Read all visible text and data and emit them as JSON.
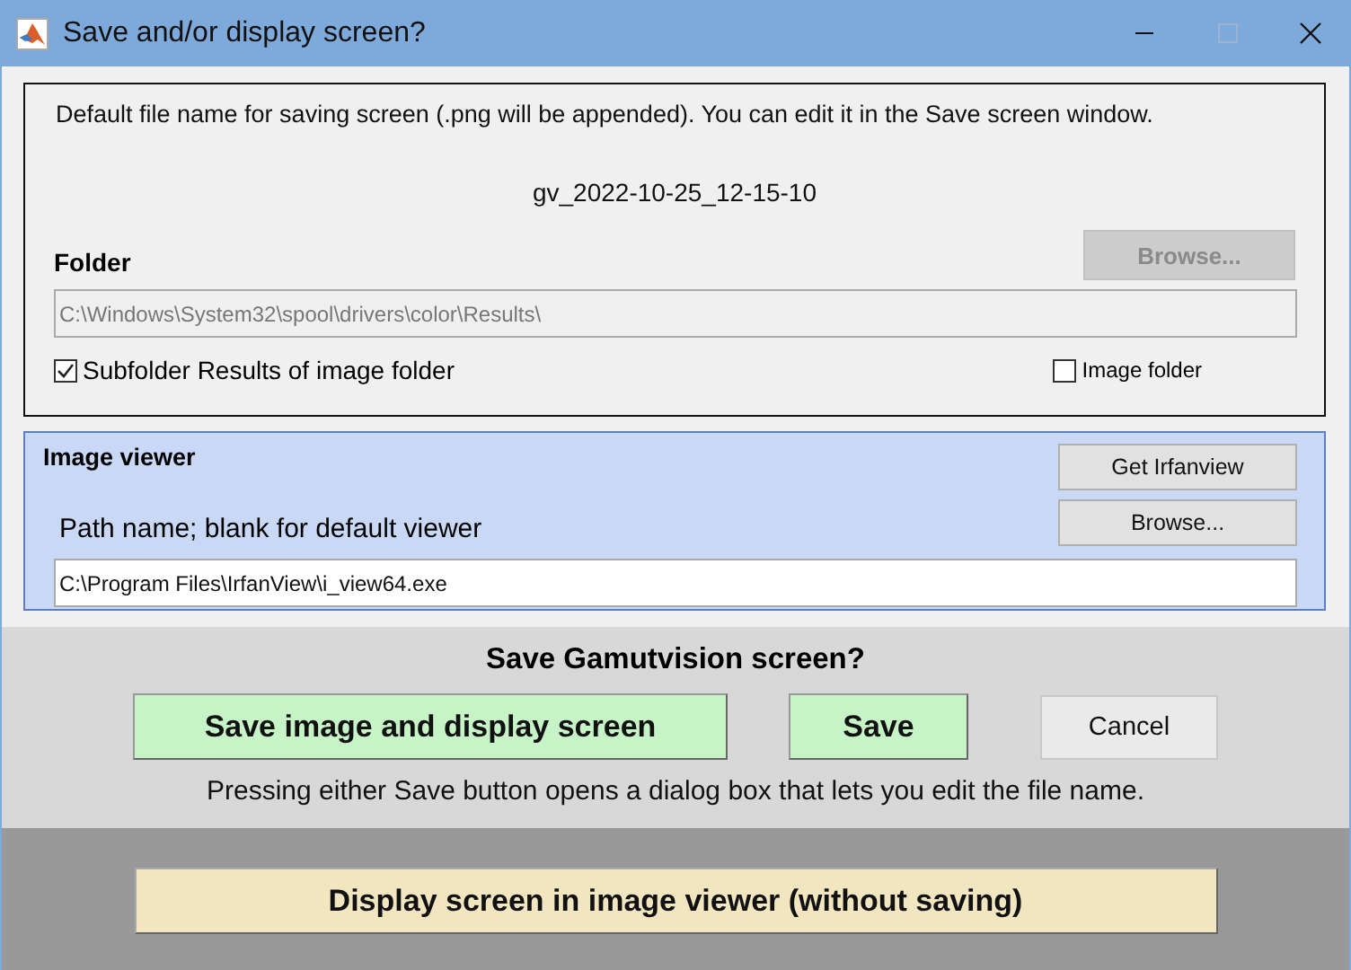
{
  "window": {
    "title": "Save and/or display screen?"
  },
  "file_section": {
    "description": "Default file name for saving screen (.png will be appended). You can edit it in the Save screen window.",
    "file_name": "gv_2022-10-25_12-15-10",
    "folder_label": "Folder",
    "browse_button": {
      "label": "Browse...",
      "disabled": true
    },
    "folder_path": {
      "value": "C:\\Windows\\System32\\spool\\drivers\\color\\Results\\",
      "disabled": true
    },
    "subfolder_checkbox": {
      "label": "Subfolder Results of image folder",
      "checked": true
    },
    "image_folder_checkbox": {
      "label": "Image folder",
      "checked": false
    }
  },
  "viewer_section": {
    "title": "Image viewer",
    "get_button": "Get Irfanview",
    "browse_button": "Browse...",
    "path_label": "Path name; blank for default viewer",
    "path": {
      "value": "C:\\Program Files\\IrfanView\\i_view64.exe"
    }
  },
  "save_section": {
    "question": "Save Gamutvision screen?",
    "buttons": [
      {
        "label": "Save image and display screen",
        "kind": "primary"
      },
      {
        "label": "Save",
        "kind": "primary"
      },
      {
        "label": "Cancel",
        "kind": "plain"
      }
    ],
    "note": "Pressing either Save button opens a dialog box that lets you edit the file name."
  },
  "display_button": {
    "label": "Display screen in image viewer (without saving)"
  }
}
